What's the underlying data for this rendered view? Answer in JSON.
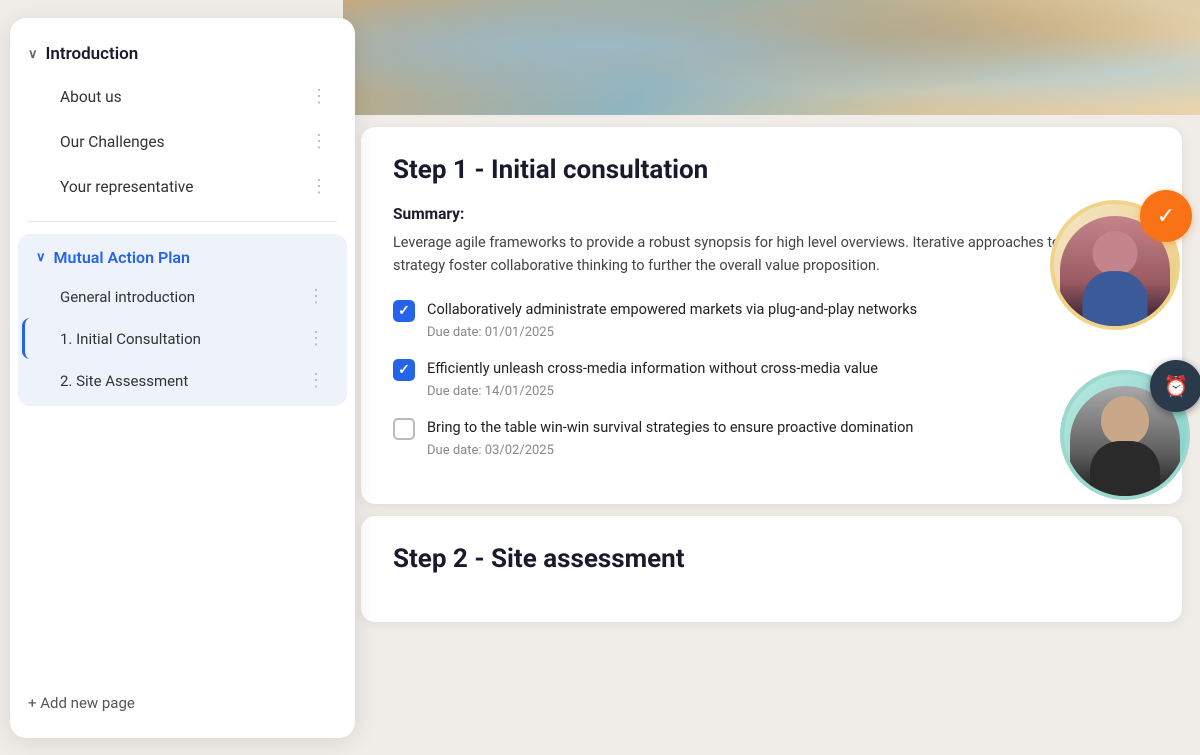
{
  "sidebar": {
    "introduction_label": "Introduction",
    "chevron_intro": "∨",
    "items": [
      {
        "label": "About us",
        "dots": "⋮"
      },
      {
        "label": "Our Challenges",
        "dots": "⋮"
      },
      {
        "label": "Your representative",
        "dots": "⋮"
      }
    ],
    "mutual_label": "Mutual Action Plan",
    "chevron_mutual": "∨",
    "sub_items": [
      {
        "label": "General introduction",
        "dots": "⋮",
        "active": false
      },
      {
        "label": "1. Initial Consultation",
        "dots": "⋮",
        "active": true
      },
      {
        "label": "2. Site Assessment",
        "dots": "⋮",
        "active": false
      }
    ],
    "add_page_label": "+ Add new page"
  },
  "main": {
    "step1": {
      "title": "Step 1 - Initial consultation",
      "summary_label": "Summary:",
      "summary_text": "Leverage agile frameworks to provide a robust synopsis for high level overviews. Iterative approaches to corporate strategy foster collaborative thinking to further the overall value proposition.",
      "tasks": [
        {
          "text": "Collaboratively administrate empowered markets via plug-and-play networks",
          "due": "Due date: 01/01/2025",
          "checked": true
        },
        {
          "text": "Efficiently unleash cross-media information without cross-media value",
          "due": "Due date: 14/01/2025",
          "checked": true
        },
        {
          "text": "Bring to the table win-win survival strategies to ensure proactive domination",
          "due": "Due date: 03/02/2025",
          "checked": false
        }
      ]
    },
    "step2": {
      "title": "Step 2 - Site assessment"
    }
  },
  "badges": {
    "orange_icon": "✓",
    "dark_icon": "🕐"
  }
}
